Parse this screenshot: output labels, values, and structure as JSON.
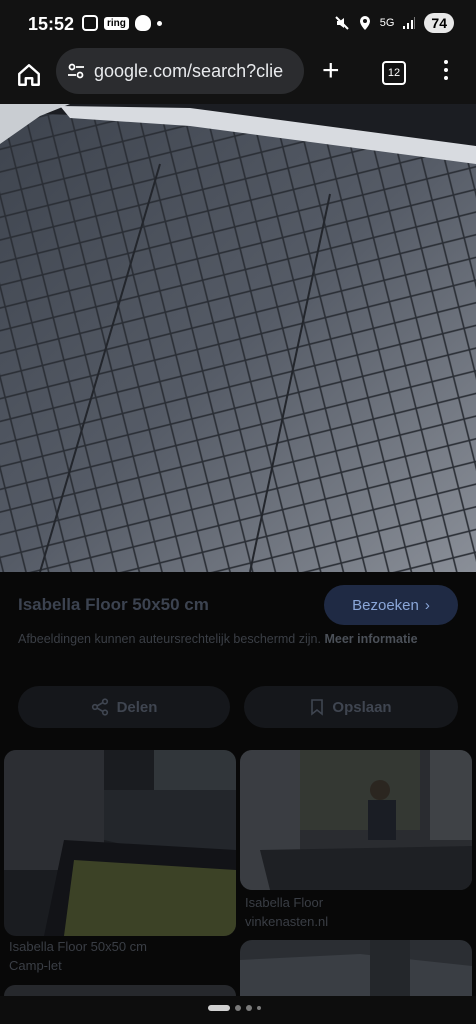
{
  "status_bar": {
    "time": "15:52",
    "ring_label": "ring",
    "network": "5G",
    "battery": "74"
  },
  "browser": {
    "url": "google.com/search?clie",
    "tab_count": "12"
  },
  "result": {
    "title": "Isabella Floor 50x50 cm",
    "visit_label": "Bezoeken",
    "copyright_text": "Afbeeldingen kunnen auteursrechtelijk beschermd zijn.",
    "more_info": "Meer informatie",
    "share_label": "Delen",
    "save_label": "Opslaan"
  },
  "related": [
    {
      "title": "Isabella Floor 50x50 cm",
      "source": "Camp-let"
    },
    {
      "title": "Isabella Floor",
      "source": "vinkenasten.nl"
    }
  ],
  "colors": {
    "accent": "#8aa6d8",
    "visit_bg": "#1f2a44"
  }
}
